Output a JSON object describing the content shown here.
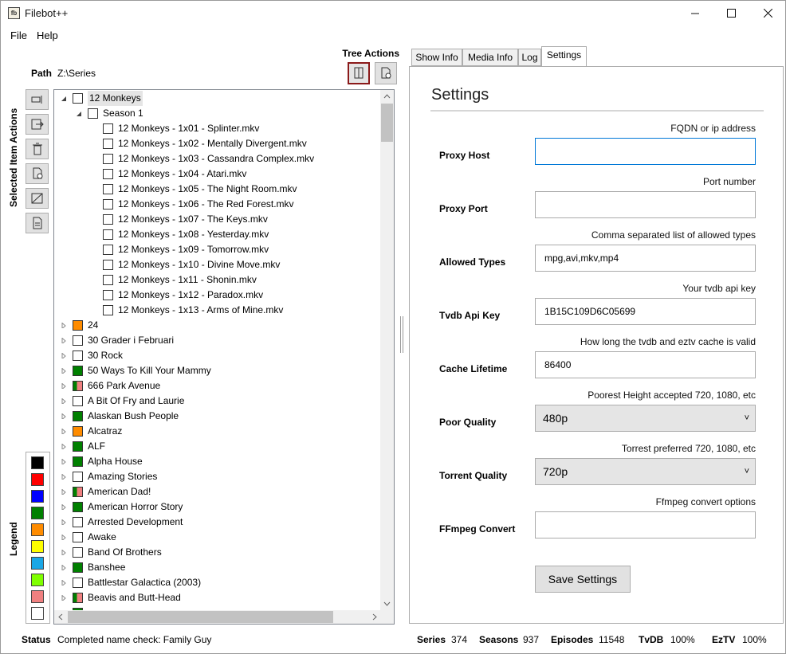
{
  "window": {
    "title": "Filebot++",
    "controls": [
      "minimize-icon",
      "maximize-icon",
      "close-icon"
    ]
  },
  "menu": {
    "file": "File",
    "help": "Help"
  },
  "tree_actions": {
    "title": "Tree Actions"
  },
  "path": {
    "label": "Path",
    "value": "Z:\\Series"
  },
  "side_panel": {
    "selected_label": "Selected Item Actions",
    "legend_label": "Legend"
  },
  "legend_colors": [
    "#000000",
    "#ff0000",
    "#0000ff",
    "#008000",
    "#ff8c00",
    "#ffff00",
    "#1aa7e6",
    "#7fff00",
    "#f08080",
    "#ffffff"
  ],
  "tree": {
    "rows": [
      {
        "text": "12 Monkeys",
        "level": 0,
        "expanded": true,
        "fill": null,
        "selected": true
      },
      {
        "text": "Season 1",
        "level": 1,
        "expanded": true,
        "fill": null
      },
      {
        "text": "12 Monkeys - 1x01 - Splinter.mkv",
        "level": 2,
        "fill": null
      },
      {
        "text": "12 Monkeys - 1x02 - Mentally Divergent.mkv",
        "level": 2,
        "fill": null
      },
      {
        "text": "12 Monkeys - 1x03 - Cassandra Complex.mkv",
        "level": 2,
        "fill": null
      },
      {
        "text": "12 Monkeys - 1x04 - Atari.mkv",
        "level": 2,
        "fill": null
      },
      {
        "text": "12 Monkeys - 1x05 - The Night Room.mkv",
        "level": 2,
        "fill": null
      },
      {
        "text": "12 Monkeys - 1x06 - The Red Forest.mkv",
        "level": 2,
        "fill": null
      },
      {
        "text": "12 Monkeys - 1x07 - The Keys.mkv",
        "level": 2,
        "fill": null
      },
      {
        "text": "12 Monkeys - 1x08 - Yesterday.mkv",
        "level": 2,
        "fill": null
      },
      {
        "text": "12 Monkeys - 1x09 - Tomorrow.mkv",
        "level": 2,
        "fill": null
      },
      {
        "text": "12 Monkeys - 1x10 - Divine Move.mkv",
        "level": 2,
        "fill": null
      },
      {
        "text": "12 Monkeys - 1x11 - Shonin.mkv",
        "level": 2,
        "fill": null
      },
      {
        "text": "12 Monkeys - 1x12 - Paradox.mkv",
        "level": 2,
        "fill": null
      },
      {
        "text": "12 Monkeys - 1x13 - Arms of Mine.mkv",
        "level": 2,
        "fill": null
      },
      {
        "text": "24",
        "level": 0,
        "expanded": false,
        "fill": "orange"
      },
      {
        "text": "30 Grader i Februari",
        "level": 0,
        "expanded": false,
        "fill": null
      },
      {
        "text": "30 Rock",
        "level": 0,
        "expanded": false,
        "fill": null
      },
      {
        "text": "50 Ways To Kill Your Mammy",
        "level": 0,
        "expanded": false,
        "fill": "green"
      },
      {
        "text": "666 Park Avenue",
        "level": 0,
        "expanded": false,
        "fill": "green-pink"
      },
      {
        "text": "A Bit Of Fry and Laurie",
        "level": 0,
        "expanded": false,
        "fill": null
      },
      {
        "text": "Alaskan Bush People",
        "level": 0,
        "expanded": false,
        "fill": "green"
      },
      {
        "text": "Alcatraz",
        "level": 0,
        "expanded": false,
        "fill": "orange"
      },
      {
        "text": "ALF",
        "level": 0,
        "expanded": false,
        "fill": "green"
      },
      {
        "text": "Alpha House",
        "level": 0,
        "expanded": false,
        "fill": "green"
      },
      {
        "text": "Amazing Stories",
        "level": 0,
        "expanded": false,
        "fill": null
      },
      {
        "text": "American Dad!",
        "level": 0,
        "expanded": false,
        "fill": "green-pink"
      },
      {
        "text": "American Horror Story",
        "level": 0,
        "expanded": false,
        "fill": "green"
      },
      {
        "text": "Arrested Development",
        "level": 0,
        "expanded": false,
        "fill": null
      },
      {
        "text": "Awake",
        "level": 0,
        "expanded": false,
        "fill": null
      },
      {
        "text": "Band Of Brothers",
        "level": 0,
        "expanded": false,
        "fill": null
      },
      {
        "text": "Banshee",
        "level": 0,
        "expanded": false,
        "fill": "green"
      },
      {
        "text": "Battlestar Galactica (2003)",
        "level": 0,
        "expanded": false,
        "fill": null
      },
      {
        "text": "Beavis and Butt-Head",
        "level": 0,
        "expanded": false,
        "fill": "green-pink"
      },
      {
        "text": "",
        "level": 0,
        "expanded": false,
        "fill": "green"
      }
    ]
  },
  "tabs": [
    {
      "label": "Show Info",
      "active": false
    },
    {
      "label": "Media Info",
      "active": false
    },
    {
      "label": "Log",
      "active": false
    },
    {
      "label": "Settings",
      "active": true
    }
  ],
  "settings": {
    "title": "Settings",
    "fields": [
      {
        "label": "Proxy Host",
        "hint": "FQDN or ip address",
        "value": "",
        "type": "text",
        "focused": true
      },
      {
        "label": "Proxy Port",
        "hint": "Port number",
        "value": "",
        "type": "text"
      },
      {
        "label": "Allowed Types",
        "hint": "Comma separated list of allowed types",
        "value": "mpg,avi,mkv,mp4",
        "type": "text"
      },
      {
        "label": "Tvdb Api Key",
        "hint": "Your tvdb api key",
        "value": "1B15C109D6C05699",
        "type": "text"
      },
      {
        "label": "Cache Lifetime",
        "hint": "How long the tvdb and eztv cache is valid",
        "value": "86400",
        "type": "text"
      },
      {
        "label": "Poor Quality",
        "hint": "Poorest Height accepted 720, 1080, etc",
        "value": "480p",
        "type": "select"
      },
      {
        "label": "Torrent Quality",
        "hint": "Torrest preferred 720, 1080, etc",
        "value": "720p",
        "type": "select"
      },
      {
        "label": "FFmpeg Convert",
        "hint": "Ffmpeg convert options",
        "value": "",
        "type": "text"
      }
    ],
    "save_label": "Save Settings"
  },
  "status": {
    "label": "Status",
    "message": "Completed name check: Family Guy",
    "series_label": "Series",
    "series": "374",
    "seasons_label": "Seasons",
    "seasons": "937",
    "episodes_label": "Episodes",
    "episodes": "11548",
    "tvdb_label": "TvDB",
    "tvdb": "100%",
    "eztv_label": "EzTV",
    "eztv": "100%"
  }
}
